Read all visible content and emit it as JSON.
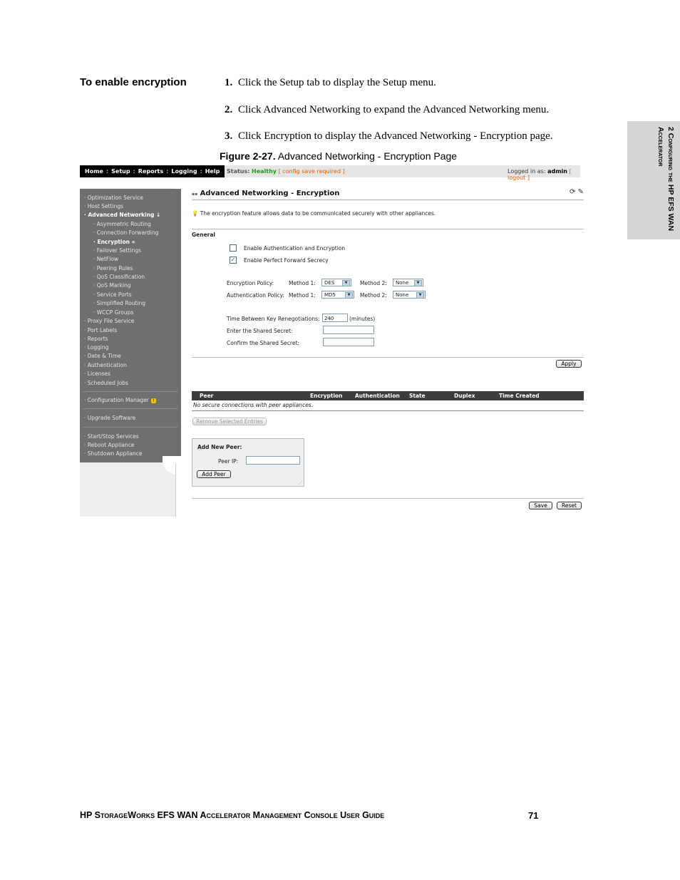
{
  "document": {
    "section_heading": "To enable encryption",
    "steps": [
      {
        "num": "1.",
        "text": "Click the Setup tab to display the Setup menu."
      },
      {
        "num": "2.",
        "text": "Click Advanced Networking to expand the Advanced Networking menu."
      },
      {
        "num": "3.",
        "text": "Click Encryption to display the Advanced Networking - Encryption page."
      }
    ],
    "figure_label": "Figure 2-27.",
    "figure_title": "Advanced Networking - Encryption Page",
    "side_tab": "2 Configuring the HP EFS WAN Accelerator",
    "footer_title": "HP StorageWorks EFS WAN Accelerator Management Console User Guide",
    "page_number": "71"
  },
  "ui": {
    "nav_tabs": [
      "Home",
      "Setup",
      "Reports",
      "Logging",
      "Help"
    ],
    "status_label": "Status:",
    "status_value": "Healthy",
    "status_note": "[ config save required ]",
    "logged_in_prefix": "Logged in as:",
    "logged_in_user": "admin",
    "logout": "[ logout ]",
    "sidebar": {
      "items": [
        "· Optimization Service",
        "· Host Settings",
        "· Advanced Networking ↓",
        "· Asymmetric Routing",
        "· Connection Forwarding",
        "· Encryption «",
        "· Failover Settings",
        "· NetFlow",
        "· Peering Rules",
        "· QoS Classification",
        "· QoS Marking",
        "· Service Ports",
        "· Simplified Routing",
        "· WCCP Groups",
        "· Proxy File Service",
        "· Port Labels",
        "· Reports",
        "· Logging",
        "· Date & Time",
        "· Authentication",
        "· Licenses",
        "· Scheduled Jobs",
        "· Configuration Manager",
        "· Upgrade Software",
        "· Start/Stop Services",
        "· Reboot Appliance",
        "· Shutdown Appliance"
      ]
    },
    "page_title": "Advanced Networking - Encryption",
    "info_text": "The encryption feature allows data to be communicated securely with other appliances.",
    "general_heading": "General",
    "enable_auth_label": "Enable Authentication and Encryption",
    "enable_pfs_label": "Enable Perfect Forward Secrecy",
    "encryption_policy_label": "Encryption Policy:",
    "authentication_policy_label": "Authentication Policy:",
    "method1_label": "Method 1:",
    "method2_label": "Method 2:",
    "enc_method1": "DES",
    "enc_method2": "None",
    "auth_method1": "MD5",
    "auth_method2": "None",
    "key_reneg_label": "Time Between Key Renegotiations:",
    "key_reneg_value": "240",
    "key_reneg_unit": "(minutes)",
    "shared_secret_label": "Enter the Shared Secret:",
    "confirm_secret_label": "Confirm the Shared Secret:",
    "apply_button": "Apply",
    "table_headers": [
      "Peer",
      "Encryption",
      "Authentication",
      "State",
      "Duplex",
      "Time Created"
    ],
    "empty_table": "No secure connections with peer appliances.",
    "remove_button": "Remove Selected Entries",
    "add_peer_heading": "Add New Peer:",
    "peer_ip_label": "Peer IP:",
    "add_peer_button": "Add Peer",
    "save_button": "Save",
    "reset_button": "Reset"
  }
}
